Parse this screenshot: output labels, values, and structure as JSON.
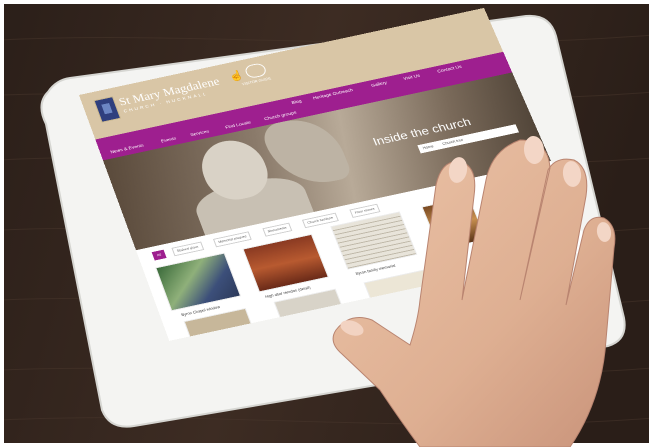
{
  "colors": {
    "table": "#3a2b22",
    "tablet_frame": "#f4f4f2",
    "header_tan": "#d9c6a6",
    "nav_purple": "#9e1f8f",
    "skin": "#e2b69b"
  },
  "site": {
    "name": "St Mary Magdalene",
    "subtitle": "CHURCH · HUCKNALL",
    "badge_icon": "hand-pointer-icon",
    "badge_text": "VISITOR GUIDE"
  },
  "nav": {
    "row1": [
      "Blog",
      "Heritage Outreach",
      "Gallery",
      "Visit Us",
      "Contact Us"
    ],
    "row2": [
      "News & Events",
      "Events",
      "Services",
      "Find Locate",
      "Church groups"
    ]
  },
  "hero": {
    "title": "Inside the church",
    "breadcrumb": [
      "Home",
      "Church tour"
    ]
  },
  "filters": {
    "items": [
      "All",
      "Stained glass",
      "Memorial plaques",
      "Monuments",
      "Church furniture",
      "Floor stones"
    ]
  },
  "gallery": {
    "captions": [
      "Byron family memorial",
      "High altar reredos (detail)",
      "Byron Chapel window"
    ]
  }
}
